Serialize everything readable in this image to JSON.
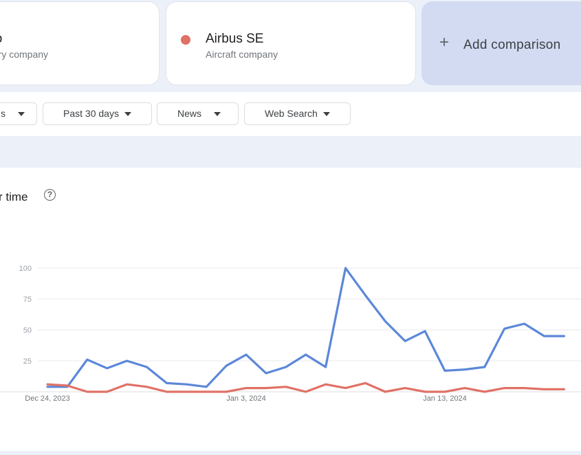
{
  "terms": [
    {
      "name": "Co",
      "type": "ustry company",
      "color": "#5b87d9"
    },
    {
      "name": "Airbus SE",
      "type": "Aircraft company",
      "color": "#e07166"
    }
  ],
  "add_comparison": {
    "icon": "plus-icon",
    "label": "Add comparison"
  },
  "filters": [
    {
      "label": "s"
    },
    {
      "label": "Past 30 days"
    },
    {
      "label": "News"
    },
    {
      "label": "Web Search"
    }
  ],
  "panel": {
    "title": "r time",
    "help_icon": "help-circle-icon"
  },
  "chart_data": {
    "type": "line",
    "x": [
      "Dec 24, 2023",
      "Dec 25",
      "Dec 26",
      "Dec 27",
      "Dec 28",
      "Dec 29",
      "Dec 30",
      "Dec 31",
      "Jan 1",
      "Jan 2",
      "Jan 3, 2024",
      "Jan 4",
      "Jan 5",
      "Jan 6",
      "Jan 7",
      "Jan 8",
      "Jan 9",
      "Jan 10",
      "Jan 11",
      "Jan 12",
      "Jan 13, 2024",
      "Jan 14",
      "Jan 15",
      "Jan 16",
      "Jan 17",
      "Jan 18",
      "Jan 19"
    ],
    "x_tick_labels": [
      "Dec 24, 2023",
      "Jan 3, 2024",
      "Jan 13, 2024"
    ],
    "y_ticks": [
      25,
      50,
      75,
      100
    ],
    "ylim": [
      0,
      100
    ],
    "series": [
      {
        "name": "Co",
        "color": "#5b87d9",
        "values": [
          4,
          4,
          26,
          19,
          25,
          20,
          7,
          6,
          4,
          21,
          30,
          15,
          20,
          30,
          20,
          100,
          78,
          57,
          41,
          49,
          17,
          18,
          20,
          51,
          55,
          45,
          45
        ]
      },
      {
        "name": "Airbus SE",
        "color": "#e07166",
        "values": [
          6,
          5,
          0,
          0,
          6,
          4,
          0,
          0,
          0,
          0,
          3,
          3,
          4,
          0,
          6,
          3,
          7,
          0,
          3,
          0,
          0,
          3,
          0,
          3,
          3,
          2,
          2
        ]
      }
    ],
    "grid": true
  }
}
